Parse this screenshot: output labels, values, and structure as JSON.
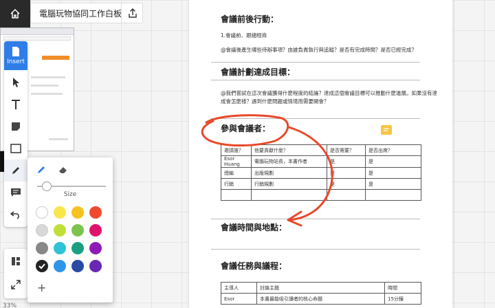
{
  "header": {
    "board_title": "電腦玩物協同工作白板",
    "home_icon": "home-icon",
    "share_icon": "share-icon"
  },
  "toolbar": {
    "insert_label": "Insert",
    "tools": [
      "pointer-icon",
      "text-icon",
      "sticky-note-icon",
      "rectangle-icon",
      "pen-icon",
      "comment-icon",
      "undo-icon"
    ],
    "bottom_tools": [
      "layout-icon",
      "fit-screen-icon"
    ]
  },
  "zoom": "33%",
  "pen_panel": {
    "size_label": "Size",
    "size_value": 0.05,
    "colors": [
      "#ffffff",
      "#f8e74b",
      "#f7c21d",
      "#ef4a2e",
      "#d8d8d8",
      "#c1df3a",
      "#7cc34f",
      "#e0136b",
      "#888888",
      "#2ec3d6",
      "#1aa081",
      "#8e1bb8",
      "#222222",
      "#2f95ea",
      "#2b4aa6",
      "#6a27b4"
    ],
    "selected_color": "#222222",
    "add_label": "+"
  },
  "document": {
    "section1": {
      "title": "會議前後行動：",
      "item": "1.會議前、跟總經商",
      "note": "@會議後產生哪些待辦事項？由誰負責執行與追蹤？是否有完成時間？是否已經完成？"
    },
    "section2": {
      "title": "會議計劃達成目標：",
      "note1": "@我們嘗試在這次會議獲得什麼程度的結論？達成這個會議目標可以推動什麼進展。如果沒有達",
      "note2": "成會怎麼樣？遇到什麼問題或情境而需要開會？"
    },
    "section3": {
      "title": "參與會議者：",
      "headers": [
        "邀請誰？",
        "他要貢獻什麼？",
        "是否需要？",
        "是否出席？"
      ],
      "rows": [
        [
          "Esor Huang",
          "電腦玩物站長，本書作者",
          "是",
          "是"
        ],
        [
          "總編",
          "出版規劃",
          "是",
          "是"
        ],
        [
          "行銷",
          "行銷規劃",
          "是",
          "是"
        ],
        [
          "",
          "",
          "",
          ""
        ]
      ]
    },
    "section4": {
      "title": "會議時間與地點："
    },
    "section5": {
      "title": "會議任務與議程：",
      "headers": [
        "主導人",
        "討論主題",
        "時間"
      ],
      "rows": [
        [
          "Esor",
          "本書最能吸引讀者的核心命題",
          "15分鐘"
        ]
      ]
    }
  },
  "annotation": {
    "color": "#e8492a"
  }
}
